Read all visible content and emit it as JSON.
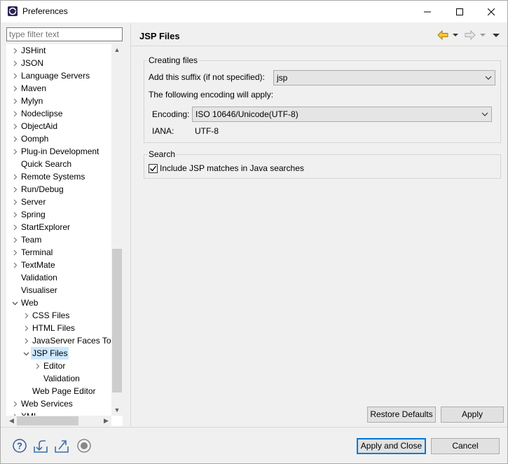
{
  "window": {
    "title": "Preferences"
  },
  "filter": {
    "placeholder": "type filter text"
  },
  "tree": [
    {
      "label": "JSHint",
      "depth": 0,
      "twisty": "collapsed"
    },
    {
      "label": "JSON",
      "depth": 0,
      "twisty": "collapsed"
    },
    {
      "label": "Language Servers",
      "depth": 0,
      "twisty": "collapsed"
    },
    {
      "label": "Maven",
      "depth": 0,
      "twisty": "collapsed"
    },
    {
      "label": "Mylyn",
      "depth": 0,
      "twisty": "collapsed"
    },
    {
      "label": "Nodeclipse",
      "depth": 0,
      "twisty": "collapsed"
    },
    {
      "label": "ObjectAid",
      "depth": 0,
      "twisty": "collapsed"
    },
    {
      "label": "Oomph",
      "depth": 0,
      "twisty": "collapsed"
    },
    {
      "label": "Plug-in Development",
      "depth": 0,
      "twisty": "collapsed"
    },
    {
      "label": "Quick Search",
      "depth": 0,
      "twisty": "none"
    },
    {
      "label": "Remote Systems",
      "depth": 0,
      "twisty": "collapsed"
    },
    {
      "label": "Run/Debug",
      "depth": 0,
      "twisty": "collapsed"
    },
    {
      "label": "Server",
      "depth": 0,
      "twisty": "collapsed"
    },
    {
      "label": "Spring",
      "depth": 0,
      "twisty": "collapsed"
    },
    {
      "label": "StartExplorer",
      "depth": 0,
      "twisty": "collapsed"
    },
    {
      "label": "Team",
      "depth": 0,
      "twisty": "collapsed"
    },
    {
      "label": "Terminal",
      "depth": 0,
      "twisty": "collapsed"
    },
    {
      "label": "TextMate",
      "depth": 0,
      "twisty": "collapsed"
    },
    {
      "label": "Validation",
      "depth": 0,
      "twisty": "none"
    },
    {
      "label": "Visualiser",
      "depth": 0,
      "twisty": "none"
    },
    {
      "label": "Web",
      "depth": 0,
      "twisty": "expanded"
    },
    {
      "label": "CSS Files",
      "depth": 1,
      "twisty": "collapsed"
    },
    {
      "label": "HTML Files",
      "depth": 1,
      "twisty": "collapsed"
    },
    {
      "label": "JavaServer Faces Too",
      "depth": 1,
      "twisty": "collapsed"
    },
    {
      "label": "JSP Files",
      "depth": 1,
      "twisty": "expanded",
      "selected": true
    },
    {
      "label": "Editor",
      "depth": 2,
      "twisty": "collapsed"
    },
    {
      "label": "Validation",
      "depth": 2,
      "twisty": "none"
    },
    {
      "label": "Web Page Editor",
      "depth": 1,
      "twisty": "none"
    },
    {
      "label": "Web Services",
      "depth": 0,
      "twisty": "collapsed"
    },
    {
      "label": "XML",
      "depth": 0,
      "twisty": "collapsed"
    }
  ],
  "page": {
    "title": "JSP Files",
    "nav_icons": [
      "back-arrow-icon",
      "forward-arrow-icon"
    ],
    "creating_files": {
      "group_label": "Creating files",
      "suffix_label": "Add this suffix (if not specified):",
      "suffix_value": "jsp",
      "encoding_note": "The following encoding will apply:",
      "encoding_label": "Encoding:",
      "encoding_value": "ISO 10646/Unicode(UTF-8)",
      "iana_label": "IANA:",
      "iana_value": "UTF-8"
    },
    "search": {
      "group_label": "Search",
      "checkbox_label": "Include JSP matches in Java searches",
      "checked": true
    }
  },
  "buttons": {
    "restore_defaults": "Restore Defaults",
    "apply": "Apply",
    "apply_and_close": "Apply and Close",
    "cancel": "Cancel"
  },
  "bottom_icons": [
    "help-icon",
    "import-icon",
    "export-icon",
    "record-icon"
  ],
  "colors": {
    "selection": "#cce8ff",
    "accent": "#0078d7",
    "nav_arrow": "#e8a000"
  }
}
